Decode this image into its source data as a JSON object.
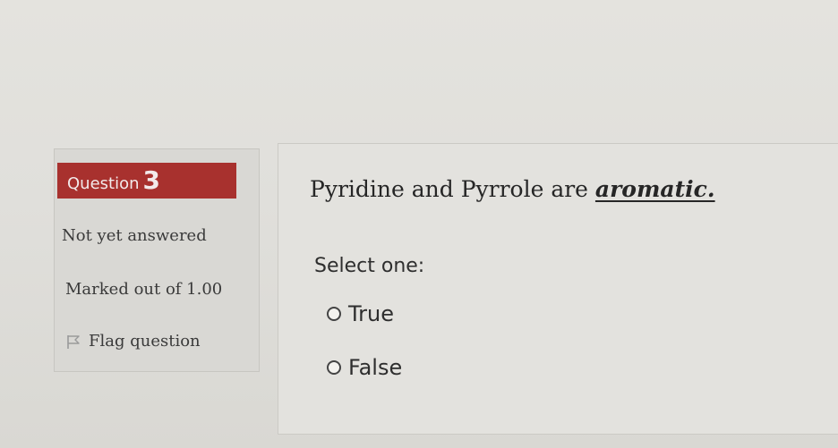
{
  "question": {
    "label": "Question",
    "number": "3",
    "state": "Not yet answered",
    "grade": "Marked out of 1.00",
    "flag_label": "Flag question",
    "flag_icon": "flag-icon",
    "banner_color": "#a8312e",
    "text_before": "Pyridine and Pyrrole are ",
    "text_emphasis": "aromatic."
  },
  "answer": {
    "prompt": "Select one:",
    "options": [
      {
        "label": "True",
        "selected": false
      },
      {
        "label": "False",
        "selected": false
      }
    ]
  }
}
